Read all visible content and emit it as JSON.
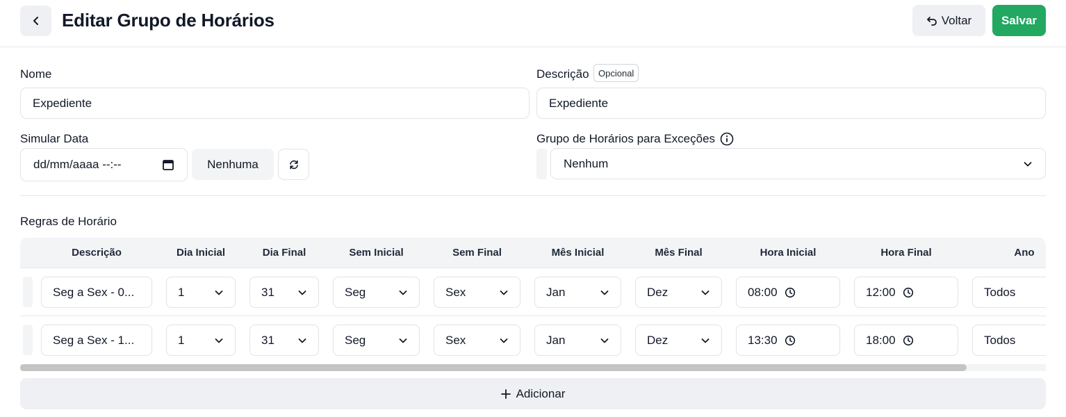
{
  "header": {
    "title": "Editar Grupo de Horários",
    "back_label": "Voltar",
    "save_label": "Salvar"
  },
  "form": {
    "nome_label": "Nome",
    "nome_value": "Expediente",
    "descricao_label": "Descrição",
    "descricao_badge": "Opcional",
    "descricao_value": "Expediente",
    "simular_label": "Simular Data",
    "simular_placeholder": "dd/mm/aaaa --:--",
    "simular_none": "Nenhuma",
    "excecoes_label": "Grupo de Horários para Exceções",
    "excecoes_value": "Nenhum"
  },
  "rules": {
    "title": "Regras de Horário",
    "columns": [
      "Descrição",
      "Dia Inicial",
      "Dia Final",
      "Sem Inicial",
      "Sem Final",
      "Mês Inicial",
      "Mês Final",
      "Hora Inicial",
      "Hora Final",
      "Ano"
    ],
    "rows": [
      {
        "descricao": "Seg a Sex - 0...",
        "dia_inicial": "1",
        "dia_final": "31",
        "sem_inicial": "Seg",
        "sem_final": "Sex",
        "mes_inicial": "Jan",
        "mes_final": "Dez",
        "hora_inicial": "08:00",
        "hora_final": "12:00",
        "ano": "Todos"
      },
      {
        "descricao": "Seg a Sex - 1...",
        "dia_inicial": "1",
        "dia_final": "31",
        "sem_inicial": "Seg",
        "sem_final": "Sex",
        "mes_inicial": "Jan",
        "mes_final": "Dez",
        "hora_inicial": "13:30",
        "hora_final": "18:00",
        "ano": "Todos"
      }
    ],
    "add_label": "Adicionar"
  },
  "colors": {
    "accent": "#22a861",
    "button_bg": "#eef0f3",
    "border": "#e0e3e8"
  },
  "icons": [
    "chevron-left-icon",
    "undo-icon",
    "calendar-icon",
    "refresh-icon",
    "info-icon",
    "chevron-down-icon",
    "clock-icon",
    "plus-icon"
  ]
}
